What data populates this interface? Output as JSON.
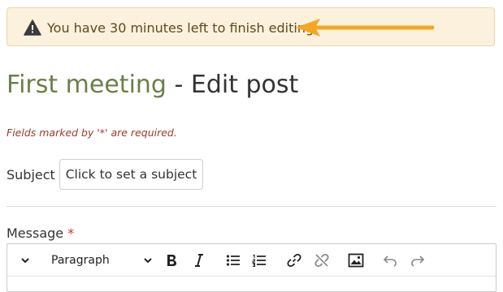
{
  "alert": {
    "icon": "warning-icon",
    "text": "You have 30 minutes left to finish editing.",
    "annotation_arrow_color": "#f5a623"
  },
  "header": {
    "course_name": "First meeting",
    "separator_and_action": " - Edit post"
  },
  "form": {
    "required_note": "Fields marked by '*' are required.",
    "subject_label": "Subject",
    "subject_button": "Click to set a subject",
    "message_label": "Message",
    "required_marker": "*"
  },
  "editor": {
    "toolbar": {
      "toggle_icon": "chevron-down-icon",
      "block_format": "Paragraph",
      "block_format_icon": "chevron-down-icon",
      "buttons": [
        "bold-icon",
        "italic-icon",
        "bullet-list-icon",
        "numbered-list-icon",
        "link-icon",
        "unlink-icon",
        "image-icon",
        "undo-icon",
        "redo-icon"
      ]
    }
  },
  "colors": {
    "course_link": "#6a7f47",
    "alert_bg": "#fbf1dd",
    "required": "#c0392b"
  }
}
